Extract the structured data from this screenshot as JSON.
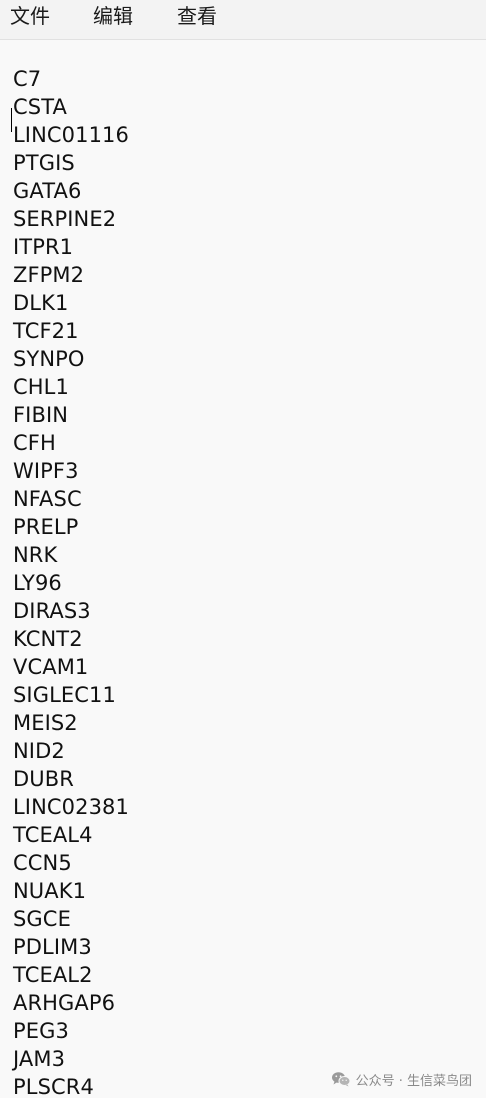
{
  "menu": {
    "file": "文件",
    "edit": "编辑",
    "view": "查看"
  },
  "editor": {
    "lines": [
      "C7",
      "CSTA",
      "LINC01116",
      "PTGIS",
      "GATA6",
      "SERPINE2",
      "ITPR1",
      "ZFPM2",
      "DLK1",
      "TCF21",
      "SYNPO",
      "CHL1",
      "FIBIN",
      "CFH",
      "WIPF3",
      "NFASC",
      "PRELP",
      "NRK",
      "LY96",
      "DIRAS3",
      "KCNT2",
      "VCAM1",
      "SIGLEC11",
      "MEIS2",
      "NID2",
      "DUBR",
      "LINC02381",
      "TCEAL4",
      "CCN5",
      "NUAK1",
      "SGCE",
      "PDLIM3",
      "TCEAL2",
      "ARHGAP6",
      "PEG3",
      "JAM3",
      "PLSCR4"
    ]
  },
  "watermark": {
    "text": "公众号 · 生信菜鸟团",
    "icon": "wechat-icon"
  }
}
